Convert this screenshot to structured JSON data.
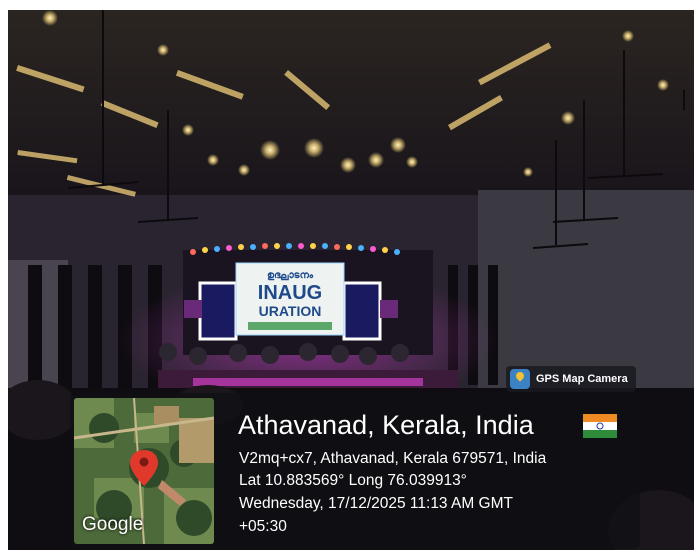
{
  "overlay": {
    "app_badge": "GPS Map Camera",
    "location_title": "Athavanad, Kerala, India",
    "address": "V2mq+cx7, Athavanad, Kerala 679571, India",
    "coordinates": "Lat 10.883569° Long 76.039913°",
    "datetime_line1": "Wednesday, 17/12/2025 11:13 AM GMT",
    "datetime_line2": "+05:30",
    "map_watermark": "Google"
  },
  "stage_screen": {
    "script_text": "ഉദ്ഘാടനം",
    "line1": "INAUG",
    "line2": "URATION"
  },
  "icons": {
    "badge": "map-pin-icon",
    "flag": "india-flag-icon",
    "map_marker": "map-marker-icon"
  },
  "colors": {
    "pin": "#e0392b",
    "stage_glow": "#d43ad0",
    "screen_bg": "#eef3f2"
  }
}
